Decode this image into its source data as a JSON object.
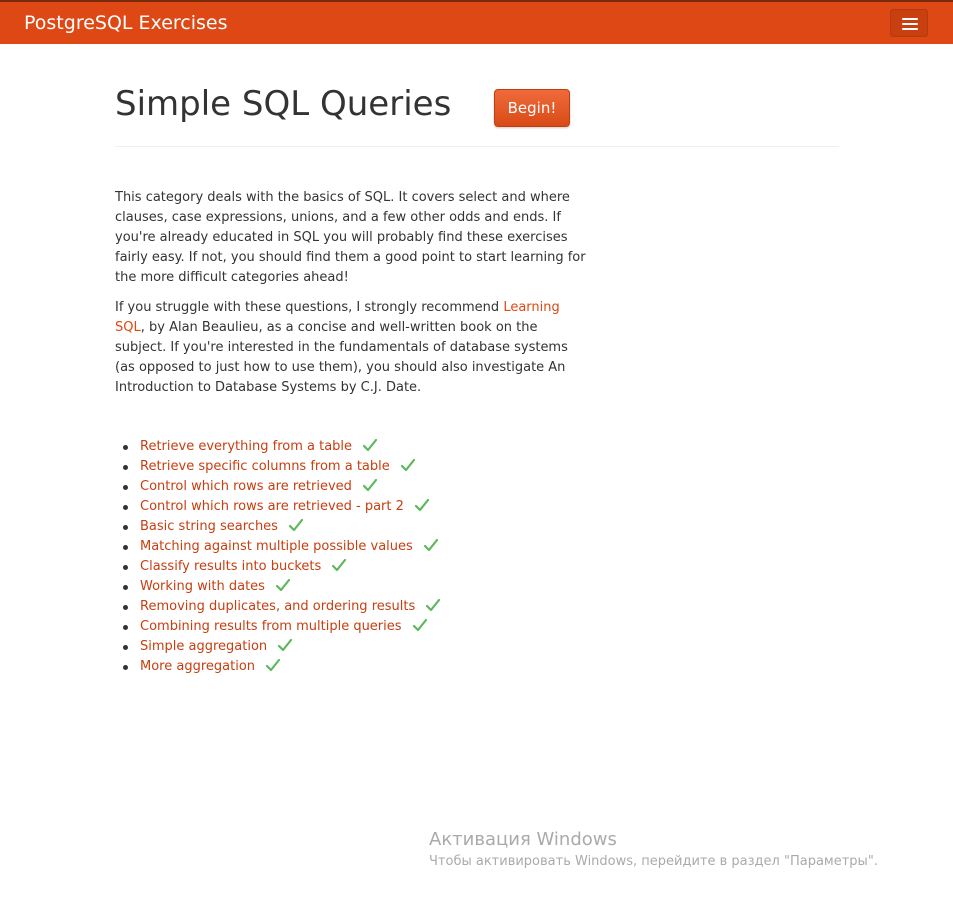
{
  "navbar": {
    "brand": "PostgreSQL Exercises",
    "brand_color": "#dd4814"
  },
  "page": {
    "title": "Simple SQL Queries",
    "begin_button": "Begin!"
  },
  "description": {
    "paragraph1": "This category deals with the basics of SQL. It covers select and where clauses, case expressions, unions, and a few other odds and ends. If you're already educated in SQL you will probably find these exercises fairly easy. If not, you should find them a good point to start learning for the more difficult categories ahead!",
    "paragraph2_before": "If you struggle with these questions, I strongly recommend ",
    "paragraph2_link": "Learning SQL",
    "paragraph2_after": ", by Alan Beaulieu, as a concise and well-written book on the subject. If you're interested in the fundamentals of database systems (as opposed to just how to use them), you should also investigate An Introduction to Database Systems by C.J. Date."
  },
  "exercises": [
    {
      "label": "Retrieve everything from a table",
      "completed": true
    },
    {
      "label": "Retrieve specific columns from a table",
      "completed": true
    },
    {
      "label": "Control which rows are retrieved",
      "completed": true
    },
    {
      "label": "Control which rows are retrieved - part 2",
      "completed": true
    },
    {
      "label": "Basic string searches",
      "completed": true
    },
    {
      "label": "Matching against multiple possible values",
      "completed": true
    },
    {
      "label": "Classify results into buckets",
      "completed": true
    },
    {
      "label": "Working with dates",
      "completed": true
    },
    {
      "label": "Removing duplicates, and ordering results",
      "completed": true
    },
    {
      "label": "Combining results from multiple queries",
      "completed": true
    },
    {
      "label": "Simple aggregation",
      "completed": true
    },
    {
      "label": "More aggregation",
      "completed": true
    }
  ],
  "watermark": {
    "title": "Активация Windows",
    "subtitle": "Чтобы активировать Windows, перейдите в раздел \"Параметры\"."
  },
  "colors": {
    "link": "#c73e10",
    "check": "#5cb85c"
  }
}
